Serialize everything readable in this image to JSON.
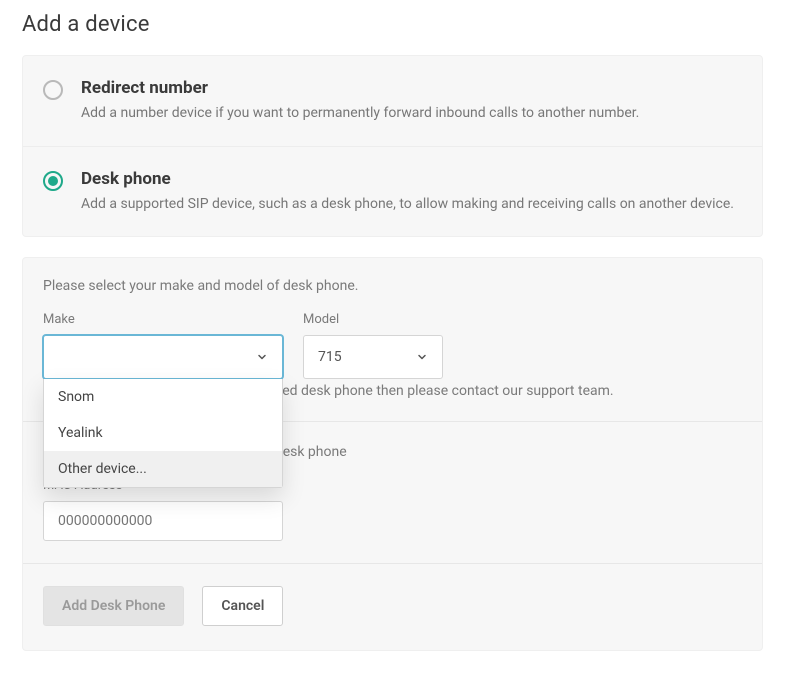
{
  "title": "Add a device",
  "deviceTypes": [
    {
      "key": "redirect",
      "label": "Redirect number",
      "description": "Add a number device if you want to permanently forward inbound calls to another number.",
      "selected": false
    },
    {
      "key": "desk",
      "label": "Desk phone",
      "description": "Add a supported SIP device, such as a desk phone, to allow making and receiving calls on another device.",
      "selected": true
    }
  ],
  "form": {
    "intro": "Please select your make and model of desk phone.",
    "make": {
      "label": "Make",
      "selected": "",
      "options": [
        {
          "label": "Snom",
          "highlight": false
        },
        {
          "label": "Yealink",
          "highlight": false
        },
        {
          "label": "Other device...",
          "highlight": true
        }
      ]
    },
    "model": {
      "label": "Model",
      "selected": "715"
    },
    "supportNote": "If your device is not listed as a supported desk phone then please contact our support team.",
    "macIntro": "Please add the MAC Address for this desk phone",
    "mac": {
      "label": "MAC Address",
      "placeholder": "000000000000",
      "value": ""
    },
    "actions": {
      "primary": "Add Desk Phone",
      "secondary": "Cancel"
    }
  }
}
